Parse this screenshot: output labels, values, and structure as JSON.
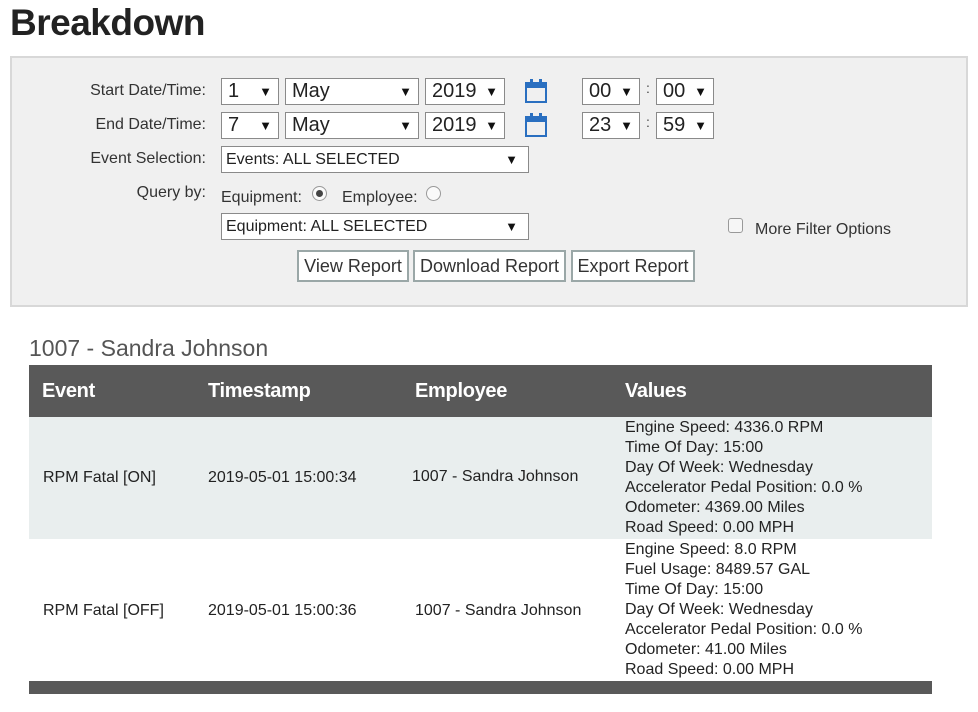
{
  "page": {
    "title": "Breakdown"
  },
  "filters": {
    "start_label": "Start Date/Time:",
    "end_label": "End Date/Time:",
    "event_label": "Event Selection:",
    "query_label": "Query by:",
    "start": {
      "day": "1",
      "month": "May",
      "year": "2019",
      "hour": "00",
      "minute": "00"
    },
    "end": {
      "day": "7",
      "month": "May",
      "year": "2019",
      "hour": "23",
      "minute": "59"
    },
    "time_separator": ":",
    "event_selection": "Events: ALL SELECTED",
    "query_equipment_label": "Equipment:",
    "query_employee_label": "Employee:",
    "query_selected": "Equipment",
    "equipment_selection": "Equipment: ALL SELECTED",
    "more_filter_label": "More Filter Options",
    "more_filter_checked": false
  },
  "buttons": {
    "view": "View Report",
    "download": "Download Report",
    "export": "Export Report"
  },
  "report": {
    "section_title": "1007 - Sandra Johnson",
    "columns": [
      "Event",
      "Timestamp",
      "Employee",
      "Values"
    ],
    "rows": [
      {
        "event": "RPM Fatal [ON]",
        "timestamp": "2019-05-01 15:00:34",
        "employee": "1007 - Sandra Johnson",
        "values": [
          "Engine Speed: 4336.0 RPM",
          "Time Of Day: 15:00",
          "Day Of Week: Wednesday",
          "Accelerator Pedal Position: 0.0 %",
          "Odometer: 4369.00 Miles",
          "Road Speed: 0.00 MPH"
        ]
      },
      {
        "event": "RPM Fatal [OFF]",
        "timestamp": "2019-05-01 15:00:36",
        "employee": "1007 - Sandra Johnson",
        "values": [
          "Engine Speed: 8.0 RPM",
          "Fuel Usage: 8489.57 GAL",
          "Time Of Day: 15:00",
          "Day Of Week: Wednesday",
          "Accelerator Pedal Position: 0.0 %",
          "Odometer: 41.00 Miles",
          "Road Speed: 0.00 MPH"
        ]
      }
    ]
  },
  "colors": {
    "panel_bg": "#f0f0f0",
    "header_bg": "#595959",
    "alt_row_bg": "#e9eeee",
    "calendar_icon": "#2a6fc0"
  },
  "icons": {
    "calendar": "calendar-icon",
    "dropdown": "caret-down-icon"
  }
}
